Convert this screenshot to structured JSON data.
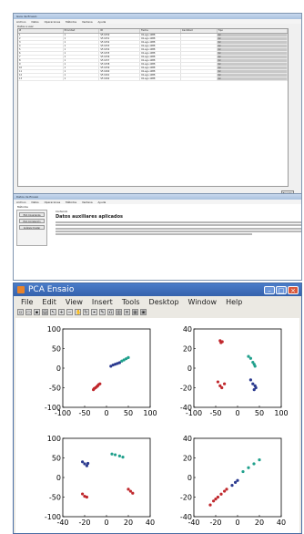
{
  "win1": {
    "title": "Guia de Ensaio",
    "menu": [
      "Archivo",
      "Datos",
      "Operaciones",
      "Métodos",
      "Ventana",
      "Ayuda"
    ],
    "section": "Datos a usar",
    "columns": [
      "#",
      "Prioridad",
      "ID",
      "Fecha",
      "Cantidad",
      "Tipo"
    ],
    "ok_label": "Ejecutar",
    "rows": [
      [
        "1",
        "1",
        "SF-1050",
        "02-ago-1988",
        "",
        "Cz"
      ],
      [
        "2",
        "1",
        "SF-1051",
        "02-ago-1988",
        "",
        "Cz"
      ],
      [
        "3",
        "1",
        "SF-1052",
        "02-ago-1988",
        "",
        "Cz"
      ],
      [
        "4",
        "1",
        "SF-1053",
        "02-ago-1988",
        "",
        "Cz"
      ],
      [
        "5",
        "1",
        "SF-1054",
        "02-ago-1988",
        "",
        "Cz"
      ],
      [
        "6",
        "1",
        "SF-1055",
        "02-ago-1988",
        "",
        "Cz"
      ],
      [
        "7",
        "1",
        "SF-1056",
        "02-ago-1988",
        "",
        "Cz"
      ],
      [
        "8",
        "1",
        "SF-1057",
        "02-ago-1988",
        "",
        "Cz"
      ],
      [
        "9",
        "1",
        "SF-1058",
        "02-ago-1988",
        "",
        "Cz"
      ],
      [
        "10",
        "1",
        "SF-1059",
        "02-ago-1988",
        "",
        "Cz"
      ],
      [
        "11",
        "1",
        "SF-1060",
        "02-ago-1988",
        "",
        "Cz"
      ],
      [
        "12",
        "1",
        "SF-1061",
        "02-ago-1988",
        "",
        "Cz"
      ],
      [
        "13",
        "1",
        "SF-1062",
        "02-ago-1988",
        "",
        "Cz"
      ]
    ]
  },
  "win2": {
    "title": "Datos de Ensaio",
    "menu": [
      "Archivo",
      "Datos",
      "Operaciones",
      "Métodos",
      "Ventana",
      "Ayuda"
    ],
    "sidebar_title": "Métodos",
    "buttons": [
      "PCA Covarianza",
      "PCA Correlación",
      "Análisis Cluster"
    ],
    "subtitle": "Contenido",
    "heading": "Datos auxiliares aplicados"
  },
  "win3": {
    "title": "PCA Ensaio",
    "menu": [
      "File",
      "Edit",
      "View",
      "Insert",
      "Tools",
      "Desktop",
      "Window",
      "Help"
    ]
  },
  "chart_data": [
    {
      "type": "scatter",
      "xlim": [
        -100,
        100
      ],
      "ylim": [
        -100,
        100
      ],
      "xticks": [
        "-100",
        "-50",
        "0",
        "50",
        "100"
      ],
      "yticks": [
        "100",
        "50",
        "0",
        "-50",
        "-100"
      ],
      "series": [
        {
          "color": "#c0282d",
          "points": [
            [
              -30,
              -55
            ],
            [
              -28,
              -52
            ],
            [
              -25,
              -50
            ],
            [
              -22,
              -47
            ],
            [
              -20,
              -45
            ],
            [
              -18,
              -42
            ],
            [
              -15,
              -40
            ]
          ]
        },
        {
          "color": "#2b3a8f",
          "points": [
            [
              10,
              5
            ],
            [
              15,
              8
            ],
            [
              20,
              10
            ],
            [
              25,
              12
            ],
            [
              30,
              14
            ]
          ]
        },
        {
          "color": "#20a08c",
          "points": [
            [
              35,
              18
            ],
            [
              40,
              21
            ],
            [
              45,
              24
            ],
            [
              50,
              27
            ]
          ]
        }
      ]
    },
    {
      "type": "scatter",
      "xlim": [
        -100,
        100
      ],
      "ylim": [
        -40,
        40
      ],
      "xticks": [
        "-100",
        "-50",
        "0",
        "50",
        "100"
      ],
      "yticks": [
        "40",
        "20",
        "0",
        "-20",
        "-40"
      ],
      "series": [
        {
          "color": "#c0282d",
          "points": [
            [
              -40,
              28
            ],
            [
              -35,
              27
            ],
            [
              -38,
              26
            ],
            [
              -45,
              -14
            ],
            [
              -40,
              -18
            ],
            [
              -30,
              -16
            ],
            [
              -36,
              -20
            ]
          ]
        },
        {
          "color": "#2b3a8f",
          "points": [
            [
              30,
              -12
            ],
            [
              35,
              -16
            ],
            [
              40,
              -18
            ],
            [
              38,
              -22
            ],
            [
              42,
              -20
            ]
          ]
        },
        {
          "color": "#20a08c",
          "points": [
            [
              25,
              12
            ],
            [
              30,
              10
            ],
            [
              35,
              6
            ],
            [
              38,
              4
            ],
            [
              40,
              2
            ]
          ]
        }
      ]
    },
    {
      "type": "scatter",
      "xlim": [
        -40,
        40
      ],
      "ylim": [
        -100,
        100
      ],
      "xticks": [
        "-40",
        "-20",
        "0",
        "20",
        "40"
      ],
      "yticks": [
        "100",
        "50",
        "0",
        "-50",
        "-100"
      ],
      "series": [
        {
          "color": "#2b3a8f",
          "points": [
            [
              -22,
              40
            ],
            [
              -20,
              35
            ],
            [
              -18,
              30
            ],
            [
              -17,
              36
            ]
          ]
        },
        {
          "color": "#c0282d",
          "points": [
            [
              -22,
              -42
            ],
            [
              -20,
              -48
            ],
            [
              -18,
              -50
            ],
            [
              20,
              -30
            ],
            [
              22,
              -35
            ],
            [
              24,
              -40
            ]
          ]
        },
        {
          "color": "#20a08c",
          "points": [
            [
              5,
              60
            ],
            [
              8,
              58
            ],
            [
              12,
              55
            ],
            [
              15,
              52
            ]
          ]
        }
      ]
    },
    {
      "type": "scatter",
      "xlim": [
        -40,
        40
      ],
      "ylim": [
        -40,
        40
      ],
      "xticks": [
        "-40",
        "-20",
        "0",
        "20",
        "40"
      ],
      "yticks": [
        "40",
        "20",
        "0",
        "-20",
        "-40"
      ],
      "series": [
        {
          "color": "#c0282d",
          "points": [
            [
              -25,
              -28
            ],
            [
              -22,
              -24
            ],
            [
              -20,
              -22
            ],
            [
              -18,
              -20
            ],
            [
              -15,
              -17
            ],
            [
              -12,
              -14
            ],
            [
              -10,
              -12
            ]
          ]
        },
        {
          "color": "#2b3a8f",
          "points": [
            [
              -5,
              -8
            ],
            [
              -2,
              -5
            ],
            [
              0,
              -3
            ]
          ]
        },
        {
          "color": "#20a08c",
          "points": [
            [
              5,
              6
            ],
            [
              10,
              10
            ],
            [
              15,
              14
            ],
            [
              20,
              18
            ]
          ]
        }
      ]
    }
  ]
}
